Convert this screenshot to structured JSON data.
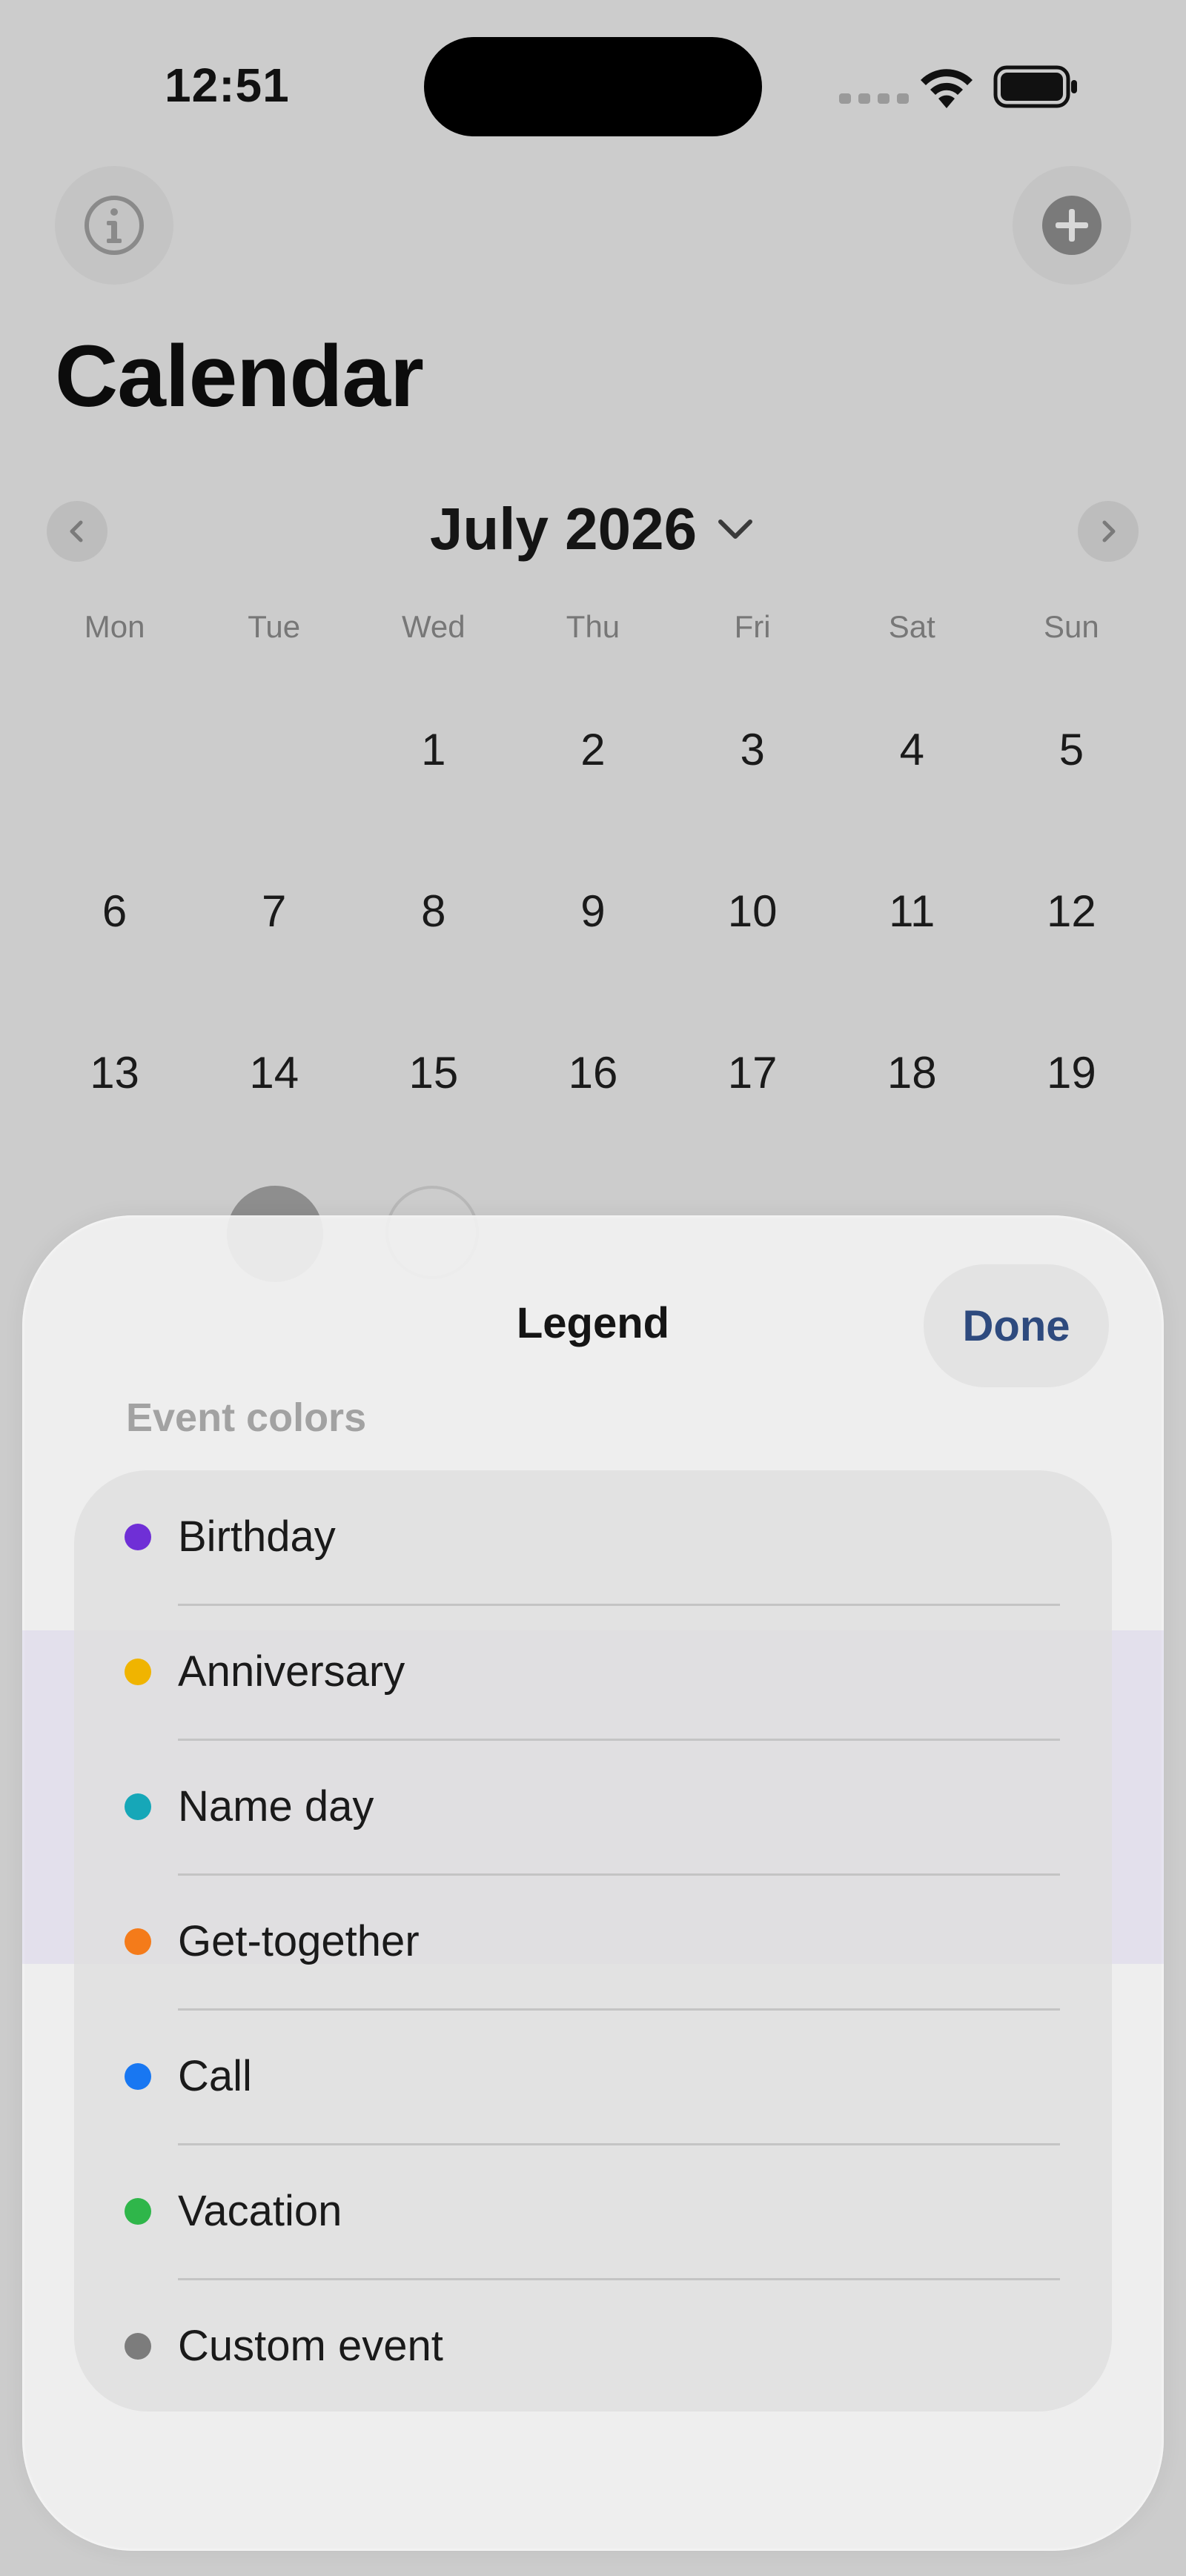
{
  "status_bar": {
    "time": "12:51"
  },
  "header": {
    "title": "Calendar",
    "info_icon": "info-circle-icon",
    "add_icon": "plus-circle-icon"
  },
  "month_nav": {
    "month_label": "July 2026",
    "prev_icon": "chevron-left-icon",
    "next_icon": "chevron-right-icon",
    "dropdown_icon": "chevron-down-icon"
  },
  "calendar": {
    "weekdays": [
      "Mon",
      "Tue",
      "Wed",
      "Thu",
      "Fri",
      "Sat",
      "Sun"
    ],
    "weeks": [
      [
        "",
        "",
        "1",
        "2",
        "3",
        "4",
        "5"
      ],
      [
        "6",
        "7",
        "8",
        "9",
        "10",
        "11",
        "12"
      ],
      [
        "13",
        "14",
        "15",
        "16",
        "17",
        "18",
        "19"
      ]
    ]
  },
  "legend_sheet": {
    "title": "Legend",
    "done_label": "Done",
    "done_color": "#2e4a7e",
    "section_header": "Event colors",
    "items": [
      {
        "label": "Birthday",
        "color": "#6f2fd6"
      },
      {
        "label": "Anniversary",
        "color": "#f0b400"
      },
      {
        "label": "Name day",
        "color": "#16a7b8"
      },
      {
        "label": "Get-together",
        "color": "#f47b1a"
      },
      {
        "label": "Call",
        "color": "#1877f2"
      },
      {
        "label": "Vacation",
        "color": "#2fb64a"
      },
      {
        "label": "Custom event",
        "color": "#7c7c7c"
      }
    ]
  }
}
